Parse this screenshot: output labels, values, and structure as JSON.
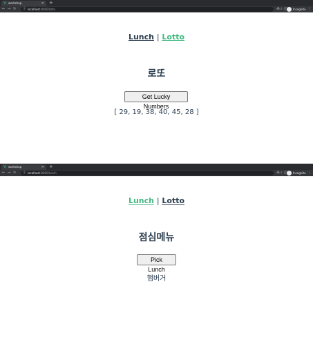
{
  "windows": [
    {
      "browser": {
        "tab_title": "workshop",
        "url_host": "localhost",
        "url_path": ":8080/lotto",
        "incognito_label": "Incognito"
      },
      "nav": {
        "lunch": "Lunch",
        "separator": "|",
        "lotto": "Lotto",
        "active": "lotto"
      },
      "heading": "로또",
      "button_label": "Get Lucky Numbers",
      "result": "[ 29, 19, 38, 40, 45, 28 ]"
    },
    {
      "browser": {
        "tab_title": "workshop",
        "url_host": "localhost",
        "url_path": ":8080/lunch",
        "incognito_label": "Incognito"
      },
      "nav": {
        "lunch": "Lunch",
        "separator": "|",
        "lotto": "Lotto",
        "active": "lunch"
      },
      "heading": "점심메뉴",
      "button_label": "Pick Lunch",
      "result": "햄버거"
    }
  ],
  "colors": {
    "active_link": "#42b983",
    "text": "#2c3e50",
    "chrome_dark": "#35363a"
  },
  "icons": [
    "vue-favicon-icon",
    "close-tab-icon",
    "new-tab-icon",
    "back-icon",
    "forward-icon",
    "reload-icon",
    "info-icon",
    "translate-icon",
    "zoom-icon",
    "extension-icon",
    "incognito-avatar-icon",
    "menu-icon"
  ]
}
